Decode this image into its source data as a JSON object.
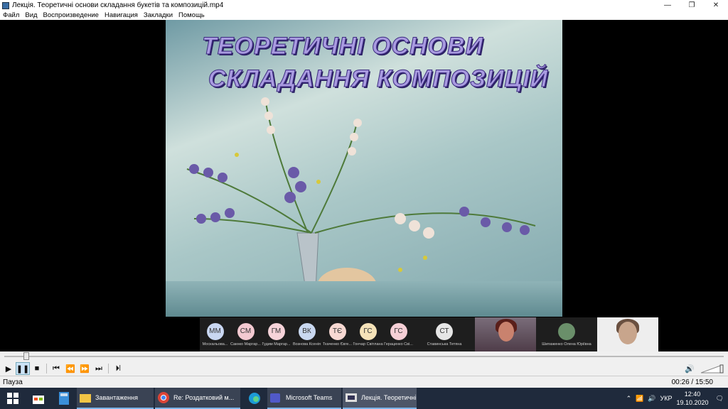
{
  "window": {
    "title": "Лекція. Теоретичні основи складання букетів та композицій.mp4",
    "minimize": "—",
    "restore": "❐",
    "close": "✕"
  },
  "menu": [
    "Файл",
    "Вид",
    "Воспроизведение",
    "Навигация",
    "Закладки",
    "Помощь"
  ],
  "slide": {
    "title_line1": "ТЕОРЕТИЧНІ ОСНОВИ",
    "title_line2": "СКЛАДАННЯ КОМПОЗИЦІЙ"
  },
  "participants": [
    {
      "initials": "ММ",
      "name": "Москальова...",
      "color": "#c9d7f2"
    },
    {
      "initials": "СМ",
      "name": "Сакнко Маргар...",
      "color": "#f3c9d1"
    },
    {
      "initials": "ГМ",
      "name": "Гудим Маргар...",
      "color": "#f6d3d9"
    },
    {
      "initials": "ВК",
      "name": "Вознова Ксенія",
      "color": "#c9d8f0"
    },
    {
      "initials": "ТЄ",
      "name": "Ткаченко Євге...",
      "color": "#f7d8d2"
    },
    {
      "initials": "ГС",
      "name": "Гончар Світлана",
      "color": "#f5e2b8"
    },
    {
      "initials": "ГС",
      "name": "Гераценко Сві...",
      "color": "#f6cfd6"
    },
    {
      "initials": "СТ",
      "name": "Ставинська Тетяна",
      "color": "#e6e6e6"
    },
    {
      "name": "Шипаженко Олена Юріївна"
    }
  ],
  "player": {
    "status": "Пауза",
    "time": "00:26 / 15:50",
    "progress": 0.027
  },
  "taskbar": {
    "tasks": [
      "Завантаження",
      "Re: Роздатковий м...",
      "Microsoft Teams",
      "Лекція. Теоретичні..."
    ],
    "lang": "УКР",
    "clock_time": "12:40",
    "clock_date": "19.10.2020"
  }
}
